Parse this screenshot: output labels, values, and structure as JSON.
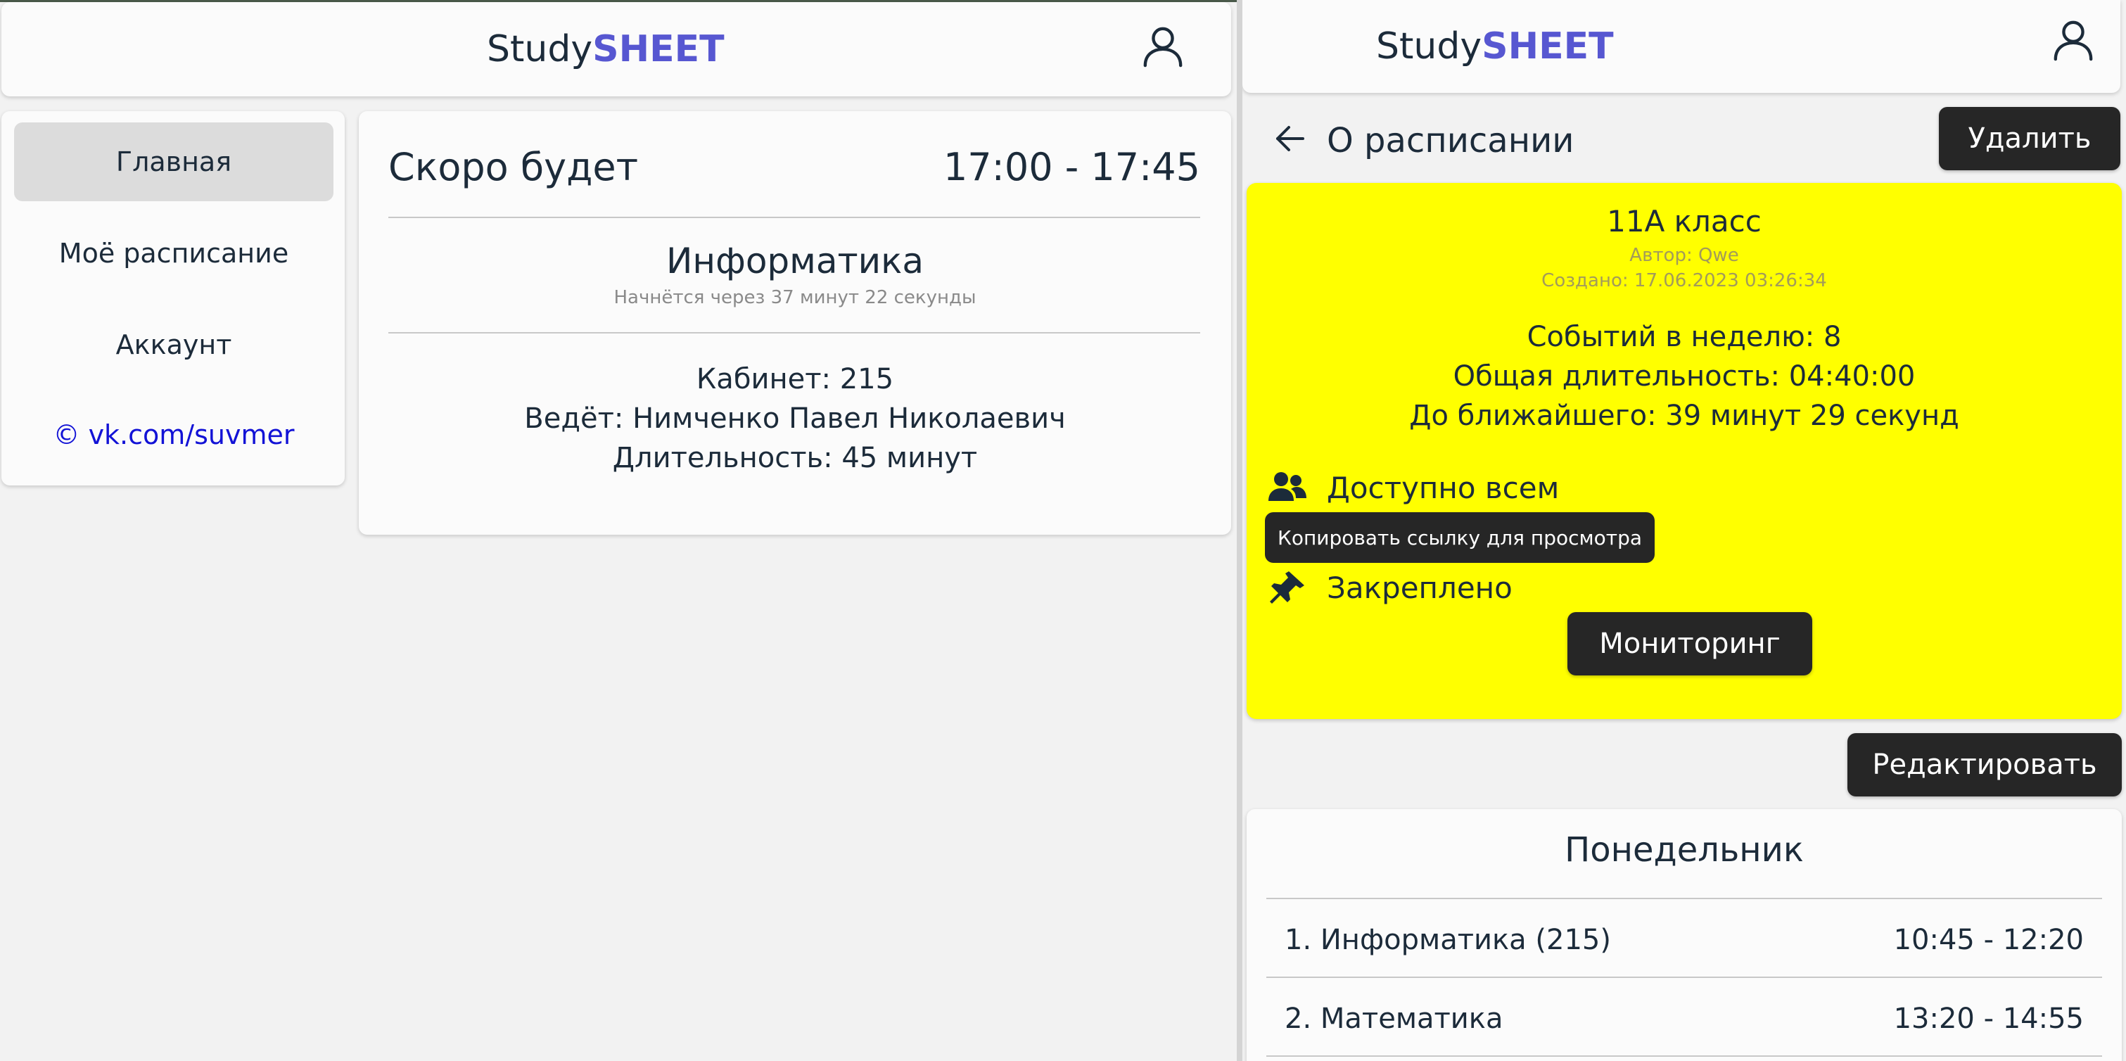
{
  "app": {
    "logo_prefix": "Study",
    "logo_accent": "SHEET",
    "accent_color": "#5757d1"
  },
  "left": {
    "nav": {
      "items": [
        {
          "label": "Главная",
          "active": true
        },
        {
          "label": "Моё расписание",
          "active": false
        },
        {
          "label": "Аккаунт",
          "active": false
        }
      ],
      "footer_link": "© vk.com/suvmer"
    },
    "upcoming": {
      "title": "Скоро будет",
      "time": "17:00 - 17:45",
      "subject": "Информатика",
      "starts_in": "Начнётся через 37 минут 22 секунды",
      "room": "Кабинет: 215",
      "teacher": "Ведёт: Нимченко Павел Николаевич",
      "duration": "Длительность: 45 минут"
    }
  },
  "right": {
    "heading": "О расписании",
    "delete_label": "Удалить",
    "schedule": {
      "title": "11А класс",
      "author": "Автор: Qwe",
      "created": "Создано: 17.06.2023 03:26:34",
      "events_per_week": "Событий в неделю: 8",
      "total_duration": "Общая длительность: 04:40:00",
      "until_next": "До ближайшего: 39 минут 29 секунд",
      "access": "Доступно всем",
      "copy_tooltip": "Копировать ссылку для просмотра",
      "pinned": "Закреплено",
      "monitor_label": "Мониторинг",
      "card_color": "#ffff00"
    },
    "edit_label": "Редактировать",
    "day": {
      "name": "Понедельник",
      "lessons": [
        {
          "name": "1. Информатика (215)",
          "time": "10:45 - 12:20"
        },
        {
          "name": "2. Математика",
          "time": "13:20 - 14:55"
        }
      ]
    }
  }
}
